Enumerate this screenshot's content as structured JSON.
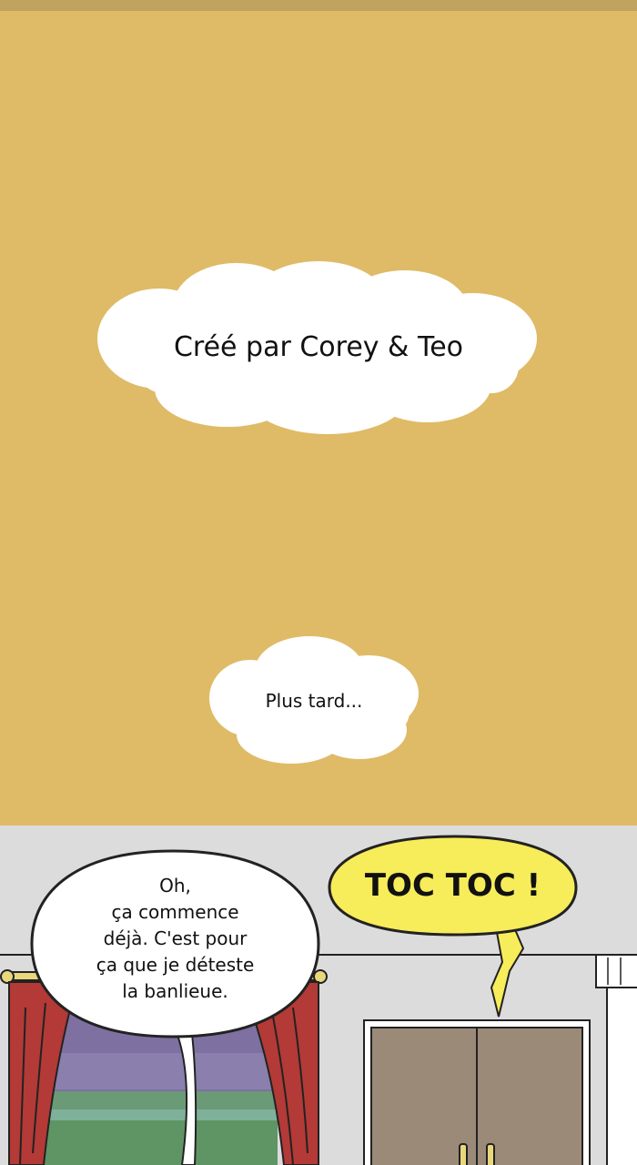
{
  "captions": {
    "credits": "Créé par Corey & Teo",
    "later": "Plus tard..."
  },
  "bubbles": {
    "speech": "Oh,\nça commence\ndéjà. C'est pour\nça que je déteste\nla banlieue.",
    "sfx": "TOC TOC !"
  },
  "colors": {
    "background_yellow": "#dfbb67",
    "wall_gray": "#dcdcdc",
    "curtain_red": "#b33a36",
    "door_brown": "#9b8a78",
    "sfx_bubble_yellow": "#f7ec5a"
  }
}
